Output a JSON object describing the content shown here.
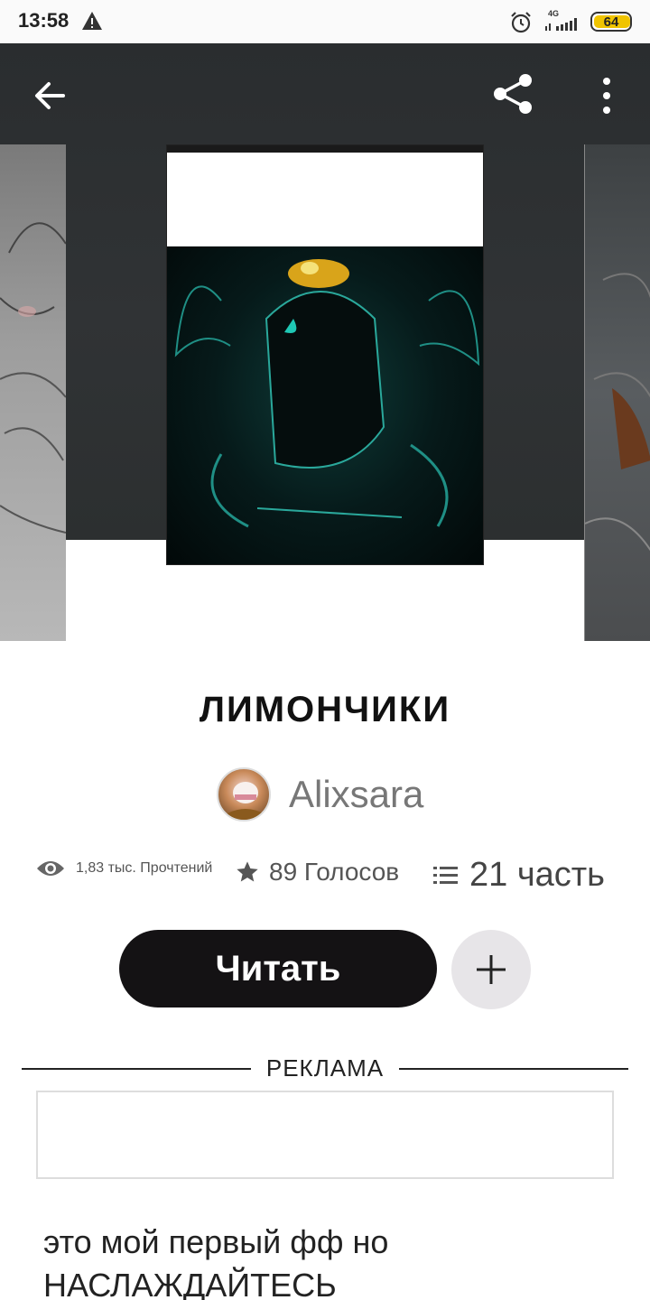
{
  "status_bar": {
    "time": "13:58",
    "network": "4G",
    "battery": "64",
    "battery_fraction": 0.64
  },
  "toolbar": {
    "back_icon": "arrow-left-icon",
    "share_icon": "share-icon",
    "more_icon": "more-vertical-icon"
  },
  "story": {
    "title": "ЛИМОНЧИКИ",
    "author": "Alixsara",
    "reads": "1,83 тыс. Прочтений",
    "votes": "89 Голосов",
    "parts": "21 часть",
    "read_button": "Читать",
    "description": "это мой первый фф но НАСЛАЖДАЙТЕСЬ"
  },
  "ad": {
    "label": "РЕКЛАМА"
  },
  "colors": {
    "button_dark": "#141214",
    "add_button_bg": "#e7e5e8",
    "battery_yellow": "#f0c400"
  }
}
